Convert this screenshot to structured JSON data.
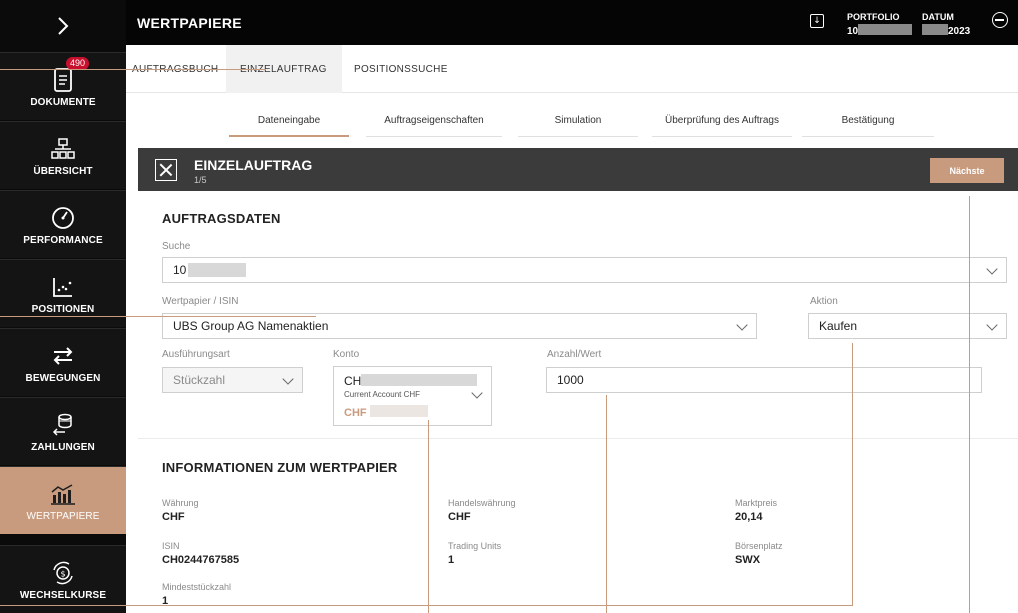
{
  "sidebar": {
    "toggle_icon": "chevron-right-icon",
    "items": [
      {
        "label": "DOKUMENTE",
        "icon": "document-icon",
        "badge": "490"
      },
      {
        "label": "ÜBERSICHT",
        "icon": "hierarchy-icon"
      },
      {
        "label": "PERFORMANCE",
        "icon": "gauge-icon"
      },
      {
        "label": "POSITIONEN",
        "icon": "scatter-chart-icon"
      },
      {
        "label": "BEWEGUNGEN",
        "icon": "transfer-arrows-icon"
      },
      {
        "label": "ZAHLUNGEN",
        "icon": "coins-icon"
      },
      {
        "label": "WERTPAPIERE",
        "icon": "stock-chart-icon",
        "active": true
      },
      {
        "label": "WECHSELKURSE",
        "icon": "currency-exchange-icon"
      }
    ]
  },
  "header": {
    "title": "WERTPAPIERE",
    "portfolio_label": "PORTFOLIO",
    "portfolio_value": "10",
    "date_label": "DATUM",
    "date_value": "2023"
  },
  "tabs": [
    "AUFTRAGSBUCH",
    "EINZELAUFTRAG",
    "POSITIONSSUCHE"
  ],
  "active_tab": "EINZELAUFTRAG",
  "steps": [
    "Dateneingabe",
    "Auftragseigenschaften",
    "Simulation",
    "Überprüfung des Auftrags",
    "Bestätigung"
  ],
  "active_step": "Dateneingabe",
  "order": {
    "title": "EINZELAUFTRAG",
    "step": "1/5",
    "next_label": "Nächste"
  },
  "auftragsdaten": {
    "title": "AUFTRAGSDATEN",
    "suche_label": "Suche",
    "suche_value": "10",
    "wertpapier_label": "Wertpapier / ISIN",
    "wertpapier_value": "UBS Group AG Namenaktien",
    "aktion_label": "Aktion",
    "aktion_value": "Kaufen",
    "ausfuehrungsart_label": "Ausführungsart",
    "ausfuehrungsart_value": "Stückzahl",
    "konto_label": "Konto",
    "konto_name": "CH",
    "konto_desc": "Current Account CHF",
    "konto_balance": "CHF",
    "anzahl_label": "Anzahl/Wert",
    "anzahl_value": "1000"
  },
  "info": {
    "title": "INFORMATIONEN ZUM WERTPAPIER",
    "waehrung_label": "Währung",
    "waehrung_value": "CHF",
    "handelswaehrung_label": "Handelswährung",
    "handelswaehrung_value": "CHF",
    "marktpreis_label": "Marktpreis",
    "marktpreis_value": "20,14",
    "isin_label": "ISIN",
    "isin_value": "CH0244767585",
    "trading_units_label": "Trading Units",
    "trading_units_value": "1",
    "boersenplatz_label": "Börsenplatz",
    "boersenplatz_value": "SWX",
    "mindest_label": "Mindeststückzahl",
    "mindest_value": "1"
  },
  "colors": {
    "accent": "#c89b7e",
    "sidebar_bg": "#0b0b0b",
    "header_bg": "#050505",
    "order_bar_bg": "#3b3b3b"
  }
}
